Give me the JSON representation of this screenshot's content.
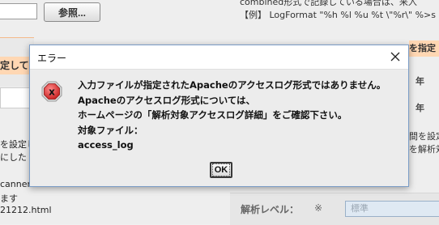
{
  "background": {
    "browse_button": "参照...",
    "left_band_text": "定してく",
    "left_lines": [
      "を設定し",
      "にした",
      "canner",
      "ます",
      "21212.html"
    ],
    "right_top_lines": [
      "combined形式で記録している場合は、来入",
      "【例】 LogFormat \"%h %l %u %t \\\"%r\\\" %>s"
    ],
    "right_band_text": "を指定",
    "right_year_1": "年",
    "right_year_2": "年",
    "right_wrap_lines": [
      "間を設定",
      "を解析対"
    ],
    "analysis_label": "解析レベル：",
    "analysis_mark": "※",
    "level_value": "標準"
  },
  "dialog": {
    "title": "エラー",
    "message_lines": [
      "入力ファイルが指定されたApacheのアクセスログ形式ではありません。",
      "Apacheのアクセスログ形式については、",
      "ホームページの「解析対象アクセスログ詳細」をご確認下さい。",
      "対象ファイル：",
      "access_log"
    ],
    "ok_label": "OK",
    "close_icon": "close-icon",
    "status_icon": "error-icon",
    "error_color": "#e03b3b"
  }
}
